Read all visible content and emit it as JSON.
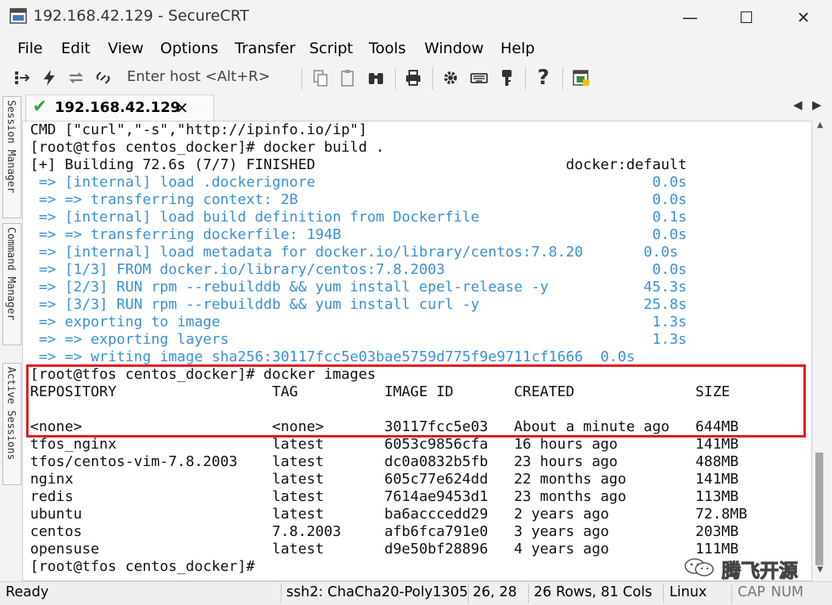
{
  "window": {
    "title": "192.168.42.129 - SecureCRT"
  },
  "menu": [
    "File",
    "Edit",
    "View",
    "Options",
    "Transfer",
    "Script",
    "Tools",
    "Window",
    "Help"
  ],
  "toolbar": {
    "quick_connect_placeholder": "Enter host <Alt+R>"
  },
  "side_tabs": [
    "Session Manager",
    "Command Manager",
    "Active Sessions"
  ],
  "tabs": [
    {
      "label": "192.168.42.129",
      "status": "connected"
    }
  ],
  "terminal": {
    "lines": [
      {
        "text": "CMD [\"curl\",\"-s\",\"http://ipinfo.io/ip\"]",
        "style": "normal"
      },
      {
        "text": "[root@tfos centos_docker]# docker build .",
        "style": "normal"
      },
      {
        "text": "[+] Building 72.6s (7/7) FINISHED                             docker:default",
        "style": "normal"
      },
      {
        "text": " => [internal] load .dockerignore                                       0.0s",
        "style": "blue"
      },
      {
        "text": " => => transferring context: 2B                                         0.0s",
        "style": "blue"
      },
      {
        "text": " => [internal] load build definition from Dockerfile                    0.1s",
        "style": "blue"
      },
      {
        "text": " => => transferring dockerfile: 194B                                    0.0s",
        "style": "blue"
      },
      {
        "text": " => [internal] load metadata for docker.io/library/centos:7.8.20       0.0s",
        "style": "blue"
      },
      {
        "text": " => [1/3] FROM docker.io/library/centos:7.8.2003                        0.0s",
        "style": "blue"
      },
      {
        "text": " => [2/3] RUN rpm --rebuilddb && yum install epel-release -y           45.3s",
        "style": "blue"
      },
      {
        "text": " => [3/3] RUN rpm --rebuilddb && yum install curl -y                   25.8s",
        "style": "blue"
      },
      {
        "text": " => exporting to image                                                  1.3s",
        "style": "blue"
      },
      {
        "text": " => => exporting layers                                                 1.3s",
        "style": "blue"
      },
      {
        "text": " => => writing image sha256:30117fcc5e03bae5759d775f9e9711cf1666  0.0s",
        "style": "blue"
      },
      {
        "text": "[root@tfos centos_docker]# docker images",
        "style": "normal"
      },
      {
        "text": "REPOSITORY                  TAG          IMAGE ID       CREATED              SIZE",
        "style": "normal"
      },
      {
        "text": "",
        "style": "normal"
      },
      {
        "text": "<none>                      <none>       30117fcc5e03   About a minute ago   644MB",
        "style": "normal"
      },
      {
        "text": "tfos_nginx                  latest       6053c9856cfa   16 hours ago         141MB",
        "style": "normal"
      },
      {
        "text": "tfos/centos-vim-7.8.2003    latest       dc0a0832b5fb   23 hours ago         488MB",
        "style": "normal"
      },
      {
        "text": "nginx                       latest       605c77e624dd   22 months ago        141MB",
        "style": "normal"
      },
      {
        "text": "redis                       latest       7614ae9453d1   23 months ago        113MB",
        "style": "normal"
      },
      {
        "text": "ubuntu                      latest       ba6acccedd29   2 years ago          72.8MB",
        "style": "normal"
      },
      {
        "text": "centos                      7.8.2003     afb6fca791e0   3 years ago          203MB",
        "style": "normal"
      },
      {
        "text": "opensuse                    latest       d9e50bf28896   4 years ago          111MB",
        "style": "normal"
      },
      {
        "text": "[root@tfos centos_docker]#",
        "style": "normal"
      }
    ]
  },
  "statusbar": {
    "ready": "Ready",
    "cipher": "ssh2: ChaCha20-Poly1305",
    "cursor": "26,  28",
    "dimensions": "26 Rows, 81 Cols",
    "os": "Linux",
    "cap": "CAP",
    "num": "NUM"
  },
  "watermark": {
    "text": "腾飞开源"
  },
  "colors": {
    "output_blue": "#3b90d6",
    "highlight_red": "#e0141a",
    "tab_check": "#22a63a"
  }
}
